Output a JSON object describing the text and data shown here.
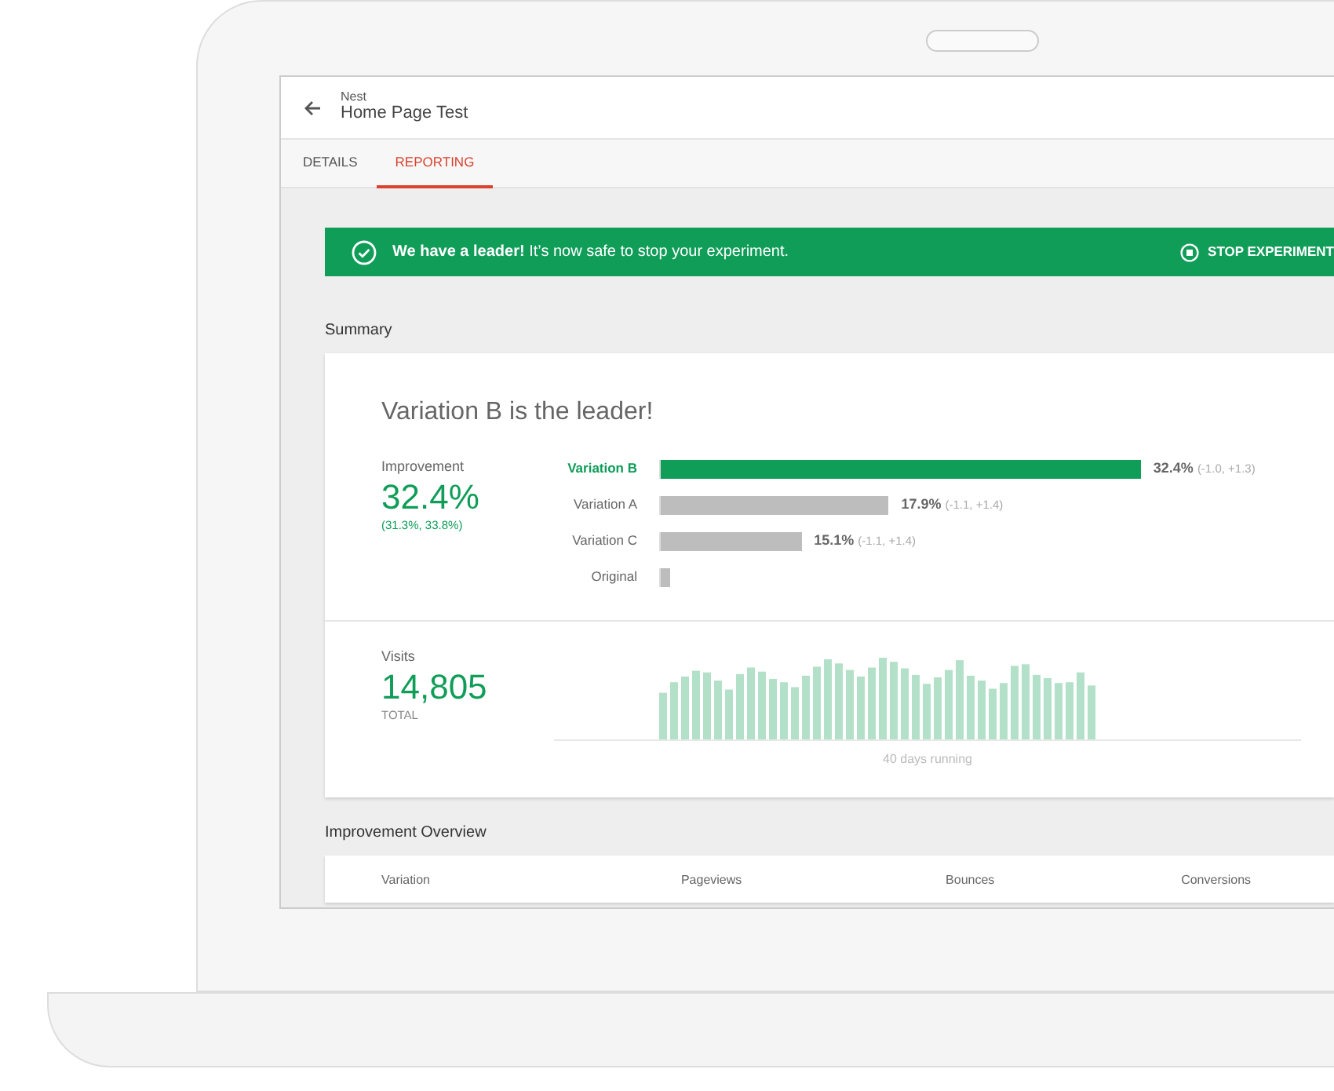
{
  "header": {
    "subtitle": "Nest",
    "title": "Home Page Test"
  },
  "tabs": [
    {
      "label": "DETAILS",
      "selected": false
    },
    {
      "label": "REPORTING",
      "selected": true
    }
  ],
  "banner": {
    "message": "**We have a leader!** It’s now safe to stop your experiment.",
    "action": "STOP EXPERIMENT"
  },
  "summary": {
    "heading": "Summary",
    "title": "Variation B is the leader!",
    "improvement": {
      "label": "Improvement",
      "value": "32.4%",
      "range": "(31.3%, 33.8%)"
    },
    "variations": [
      {
        "name": "Variation B",
        "leader": true,
        "level": 0.99,
        "value": "32.4%",
        "interval": "(-1.0, +1.3)"
      },
      {
        "name": "Variation A",
        "leader": false,
        "level": 0.47,
        "value": "17.9%",
        "interval": "(-1.1, +1.4)"
      },
      {
        "name": "Variation C",
        "leader": false,
        "level": 0.29,
        "value": "15.1%",
        "interval": "(-1.1, +1.4)"
      },
      {
        "name": "Original",
        "leader": false,
        "level": 0.02
      }
    ],
    "visits": {
      "label": "Visits",
      "value": "14,805",
      "unit": "TOTAL",
      "caption": "40 days running"
    }
  },
  "overview": {
    "heading": "Improvement Overview",
    "columns": [
      "Variation",
      "Pageviews",
      "Bounces",
      "Conversions"
    ]
  }
}
